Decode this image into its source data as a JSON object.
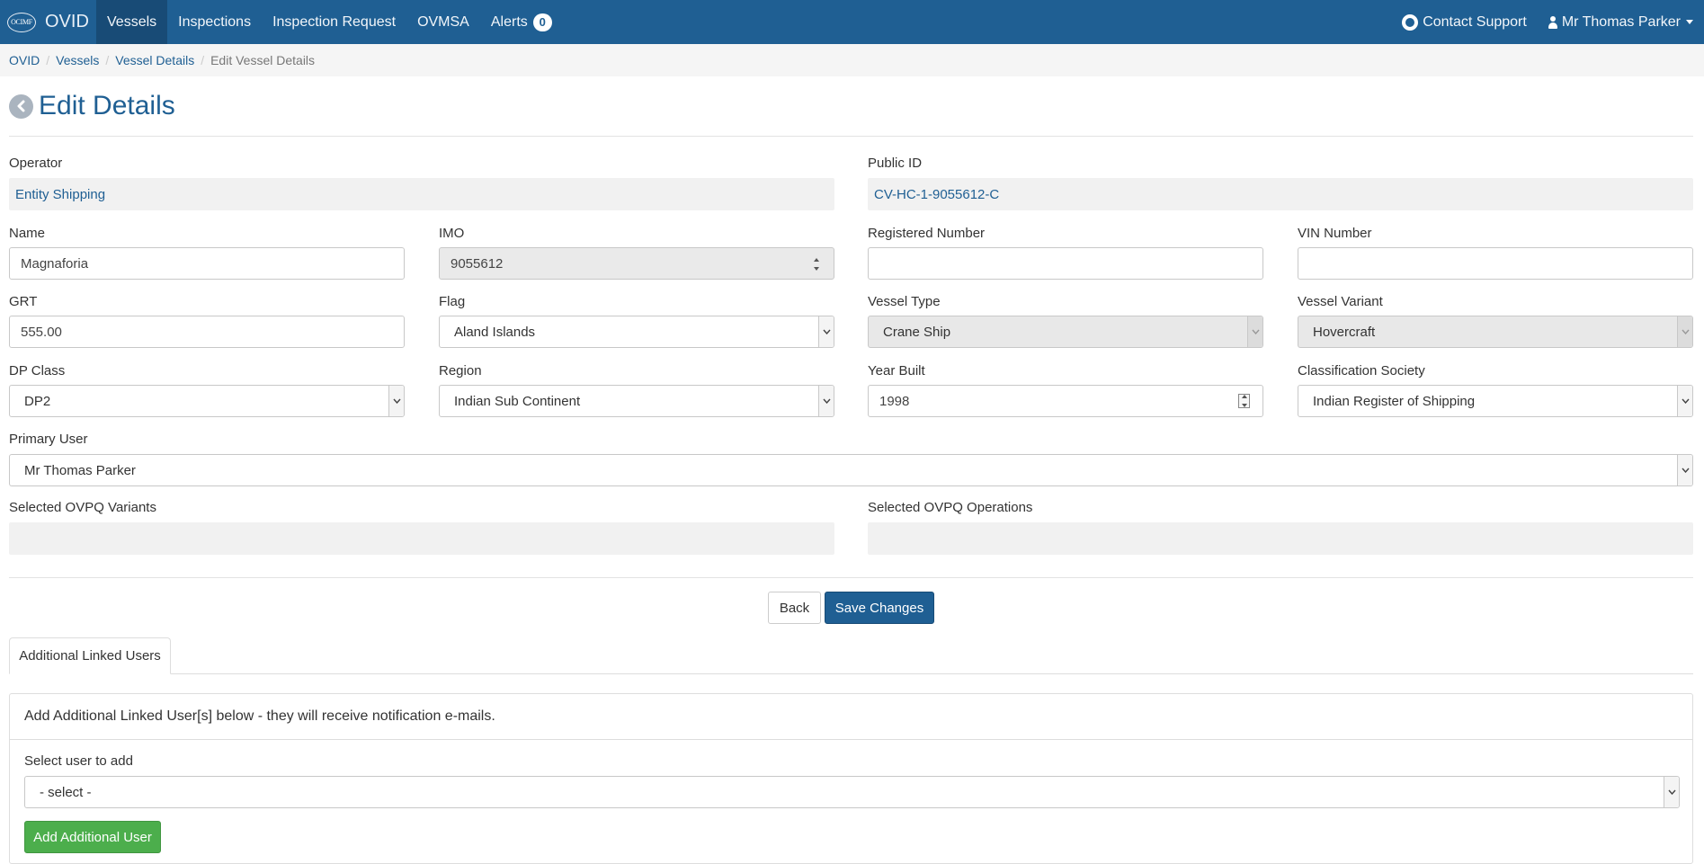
{
  "navbar": {
    "logo_text": "OCIMF",
    "brand": "OVID",
    "items": [
      {
        "label": "Vessels",
        "active": true
      },
      {
        "label": "Inspections",
        "active": false
      },
      {
        "label": "Inspection Request",
        "active": false
      },
      {
        "label": "OVMSA",
        "active": false
      },
      {
        "label": "Alerts",
        "active": false,
        "badge": "0"
      }
    ],
    "contact_support": "Contact Support",
    "user": "Mr Thomas Parker"
  },
  "breadcrumb": [
    "OVID",
    "Vessels",
    "Vessel Details",
    "Edit Vessel Details"
  ],
  "page": {
    "title": "Edit Details"
  },
  "form": {
    "operator": {
      "label": "Operator",
      "value": "Entity Shipping"
    },
    "public_id": {
      "label": "Public ID",
      "value": "CV-HC-1-9055612-C"
    },
    "name": {
      "label": "Name",
      "value": "Magnaforia"
    },
    "imo": {
      "label": "IMO",
      "value": "9055612"
    },
    "registered_number": {
      "label": "Registered Number",
      "value": ""
    },
    "vin_number": {
      "label": "VIN Number",
      "value": ""
    },
    "grt": {
      "label": "GRT",
      "value": "555.00"
    },
    "flag": {
      "label": "Flag",
      "value": "Aland Islands"
    },
    "vessel_type": {
      "label": "Vessel Type",
      "value": "Crane Ship"
    },
    "vessel_variant": {
      "label": "Vessel Variant",
      "value": "Hovercraft"
    },
    "dp_class": {
      "label": "DP Class",
      "value": "DP2"
    },
    "region": {
      "label": "Region",
      "value": "Indian Sub Continent"
    },
    "year_built": {
      "label": "Year Built",
      "value": "1998"
    },
    "classification_society": {
      "label": "Classification Society",
      "value": "Indian Register of Shipping"
    },
    "primary_user": {
      "label": "Primary User",
      "value": "Mr Thomas Parker"
    },
    "ovpq_variants": {
      "label": "Selected OVPQ Variants",
      "value": ""
    },
    "ovpq_operations": {
      "label": "Selected OVPQ Operations",
      "value": ""
    }
  },
  "actions": {
    "back": "Back",
    "save": "Save Changes"
  },
  "linked_users": {
    "tab_label": "Additional Linked Users",
    "panel_heading": "Add Additional Linked User[s] below - they will receive notification e-mails.",
    "select_label": "Select user to add",
    "select_value": "- select -",
    "add_button": "Add Additional User"
  },
  "colors": {
    "navbar": "#1f5f93",
    "primary": "#1f5f93",
    "success": "#4cae4c"
  }
}
